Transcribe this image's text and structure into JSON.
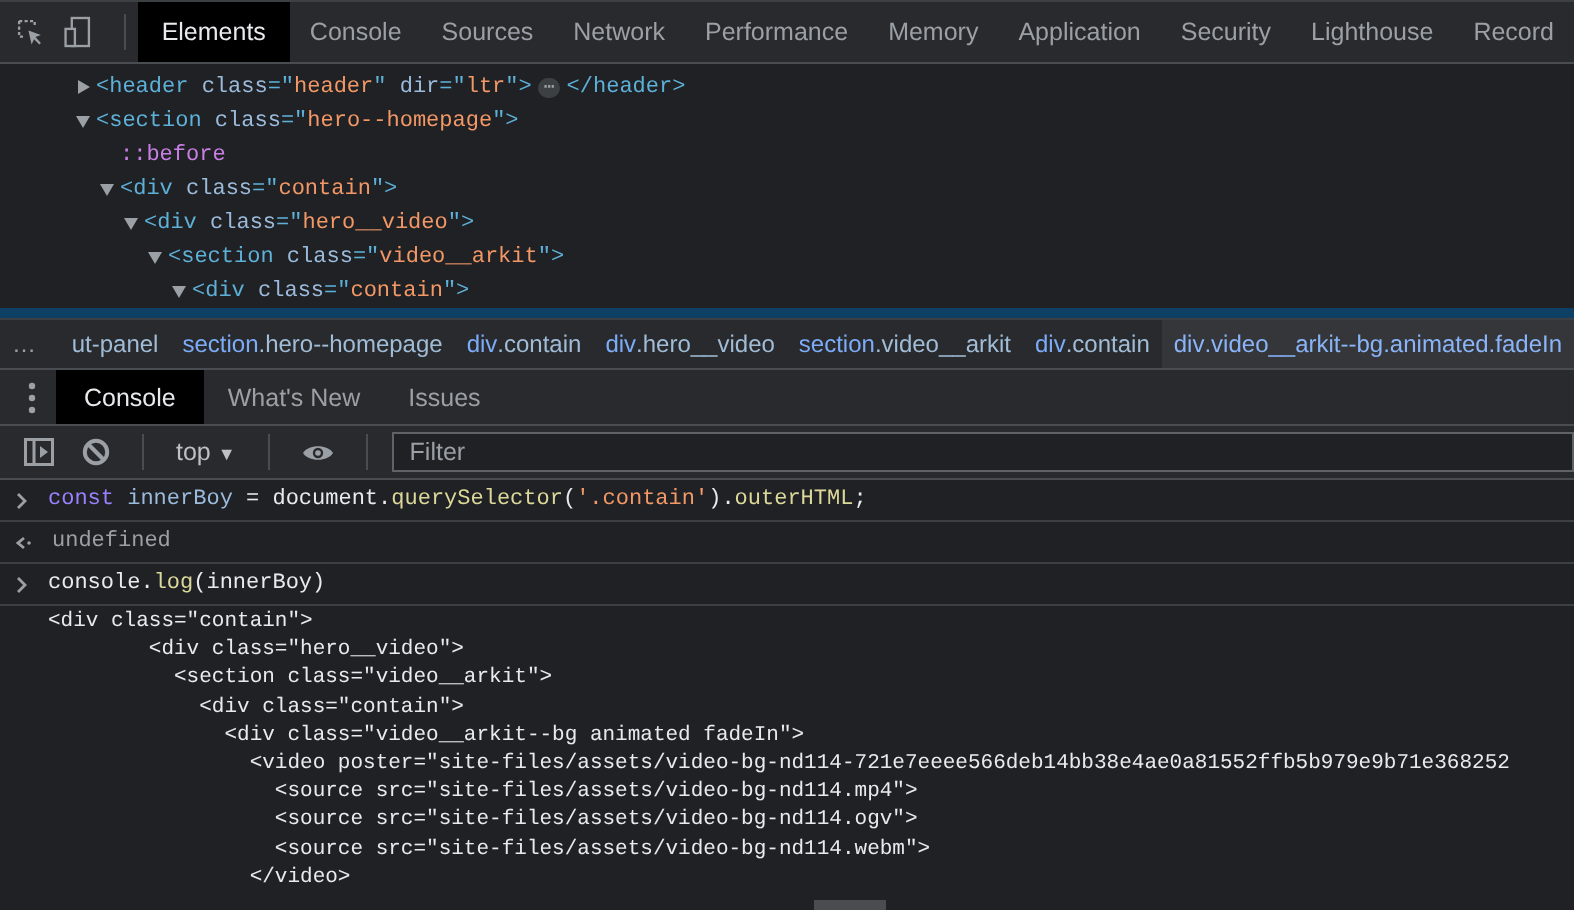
{
  "main_tabs": [
    {
      "label": "Elements",
      "selected": true
    },
    {
      "label": "Console",
      "selected": false
    },
    {
      "label": "Sources",
      "selected": false
    },
    {
      "label": "Network",
      "selected": false
    },
    {
      "label": "Performance",
      "selected": false
    },
    {
      "label": "Memory",
      "selected": false
    },
    {
      "label": "Application",
      "selected": false
    },
    {
      "label": "Security",
      "selected": false
    },
    {
      "label": "Lighthouse",
      "selected": false
    },
    {
      "label": "Record",
      "selected": false
    }
  ],
  "dom_tree": [
    {
      "expanded": false,
      "tokens": [
        {
          "kind": "tag",
          "text": "<header "
        },
        {
          "kind": "attr",
          "text": "class"
        },
        {
          "kind": "tag",
          "text": "=\""
        },
        {
          "kind": "value",
          "text": "header"
        },
        {
          "kind": "tag",
          "text": "\" "
        },
        {
          "kind": "attr",
          "text": "dir"
        },
        {
          "kind": "tag",
          "text": "=\""
        },
        {
          "kind": "value",
          "text": "ltr"
        },
        {
          "kind": "tag",
          "text": "\">"
        },
        {
          "kind": "badge",
          "text": "⋯"
        },
        {
          "kind": "tag",
          "text": "</header>"
        }
      ]
    },
    {
      "expanded": true,
      "tokens": [
        {
          "kind": "tag",
          "text": "<section "
        },
        {
          "kind": "attr",
          "text": "class"
        },
        {
          "kind": "tag",
          "text": "=\""
        },
        {
          "kind": "value",
          "text": "hero--homepage"
        },
        {
          "kind": "tag",
          "text": "\">"
        }
      ],
      "children": [
        {
          "tokens": [
            {
              "kind": "pseudo",
              "text": "::before"
            }
          ]
        },
        {
          "expanded": true,
          "tokens": [
            {
              "kind": "tag",
              "text": "<div "
            },
            {
              "kind": "attr",
              "text": "class"
            },
            {
              "kind": "tag",
              "text": "=\""
            },
            {
              "kind": "value",
              "text": "contain"
            },
            {
              "kind": "tag",
              "text": "\">"
            }
          ],
          "children": [
            {
              "expanded": true,
              "tokens": [
                {
                  "kind": "tag",
                  "text": "<div "
                },
                {
                  "kind": "attr",
                  "text": "class"
                },
                {
                  "kind": "tag",
                  "text": "=\""
                },
                {
                  "kind": "value",
                  "text": "hero__video"
                },
                {
                  "kind": "tag",
                  "text": "\">"
                }
              ],
              "children": [
                {
                  "expanded": true,
                  "tokens": [
                    {
                      "kind": "tag",
                      "text": "<section "
                    },
                    {
                      "kind": "attr",
                      "text": "class"
                    },
                    {
                      "kind": "tag",
                      "text": "=\""
                    },
                    {
                      "kind": "value",
                      "text": "video__arkit"
                    },
                    {
                      "kind": "tag",
                      "text": "\">"
                    }
                  ],
                  "children": [
                    {
                      "expanded": true,
                      "tokens": [
                        {
                          "kind": "tag",
                          "text": "<div "
                        },
                        {
                          "kind": "attr",
                          "text": "class"
                        },
                        {
                          "kind": "tag",
                          "text": "=\""
                        },
                        {
                          "kind": "value",
                          "text": "contain"
                        },
                        {
                          "kind": "tag",
                          "text": "\">"
                        }
                      ]
                    }
                  ]
                }
              ]
            }
          ]
        }
      ]
    }
  ],
  "breadcrumbs": {
    "more": "…",
    "items": [
      {
        "cls": "ut-panel",
        "selected": false
      },
      {
        "tag": "section",
        "cls": ".hero--homepage",
        "selected": false
      },
      {
        "tag": "div",
        "cls": ".contain",
        "selected": false
      },
      {
        "tag": "div",
        "cls": ".hero__video",
        "selected": false
      },
      {
        "tag": "section",
        "cls": ".video__arkit",
        "selected": false
      },
      {
        "tag": "div",
        "cls": ".contain",
        "selected": false
      },
      {
        "tag": "div",
        "cls": ".video__arkit--bg.animated.fadeIn",
        "selected": true
      }
    ]
  },
  "drawer_tabs": [
    {
      "label": "Console",
      "selected": true
    },
    {
      "label": "What's New",
      "selected": false
    },
    {
      "label": "Issues",
      "selected": false
    }
  ],
  "console_toolbar": {
    "context": "top",
    "context_arrow": "▼",
    "filter": {
      "placeholder": "Filter"
    }
  },
  "console_entries": [
    {
      "kind": "input",
      "tokens": [
        {
          "kind": "keyword",
          "text": "const "
        },
        {
          "kind": "variable",
          "text": "innerBoy"
        },
        {
          "kind": "plain",
          "text": " = document."
        },
        {
          "kind": "function",
          "text": "querySelector"
        },
        {
          "kind": "plain",
          "text": "("
        },
        {
          "kind": "string",
          "text": "'.contain'"
        },
        {
          "kind": "plain",
          "text": ")."
        },
        {
          "kind": "function",
          "text": "outerHTML"
        },
        {
          "kind": "plain",
          "text": ";"
        }
      ]
    },
    {
      "kind": "result",
      "tokens": [
        {
          "kind": "muted",
          "text": "undefined"
        }
      ]
    },
    {
      "kind": "input",
      "tokens": [
        {
          "kind": "plain",
          "text": "console."
        },
        {
          "kind": "function",
          "text": "log"
        },
        {
          "kind": "plain",
          "text": "(innerBoy)"
        }
      ]
    },
    {
      "kind": "log",
      "lines": [
        "<div class=\"contain\">",
        "        <div class=\"hero__video\">",
        "          <section class=\"video__arkit\">",
        "            <div class=\"contain\">",
        "              <div class=\"video__arkit--bg animated fadeIn\">",
        "                <video poster=\"site-files/assets/video-bg-nd114-721e7eeee566deb14bb38e4ae0a81552ffb5b979e9b71e368252",
        "                  <source src=\"site-files/assets/video-bg-nd114.mp4\">",
        "                  <source src=\"site-files/assets/video-bg-nd114.ogv\">",
        "                  <source src=\"site-files/assets/video-bg-nd114.webm\">",
        "                </video>"
      ]
    }
  ]
}
